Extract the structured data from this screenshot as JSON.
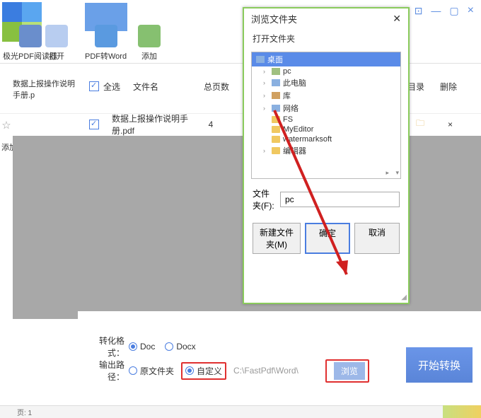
{
  "toolbar": {
    "reader": "极光PDF阅读器",
    "open": "打开",
    "toword": "PDF转Word",
    "add": "添加"
  },
  "columns": {
    "select_all": "全选",
    "filename": "文件名",
    "pages": "总页数",
    "open_dir": "打开目录",
    "delete": "删除"
  },
  "breadcrumb": "数据上报操作说明手册.p",
  "left_label": "添加",
  "file": {
    "name": "数据上报操作说明手册.pdf",
    "pages": "4",
    "del": "×"
  },
  "bottom": {
    "format_label": "转化格式：",
    "fmt_doc": "Doc",
    "fmt_docx": "Docx",
    "out_label": "输出路径：",
    "out_orig": "原文件夹",
    "out_custom": "自定义",
    "path": "C:\\FastPdf\\Word\\",
    "browse": "浏览",
    "start": "开始转换"
  },
  "dialog": {
    "title": "浏览文件夹",
    "subtitle": "打开文件夹",
    "tree": {
      "root": "桌面",
      "items": [
        "pc",
        "此电脑",
        "库",
        "网络",
        "FS",
        "MyEditor",
        "watermarksoft",
        "编辑器"
      ]
    },
    "folder_label": "文件夹(F):",
    "folder_value": "pc",
    "new_folder": "新建文件夹(M)",
    "ok": "确定",
    "cancel": "取消"
  },
  "status": {
    "page": "页: 1"
  }
}
